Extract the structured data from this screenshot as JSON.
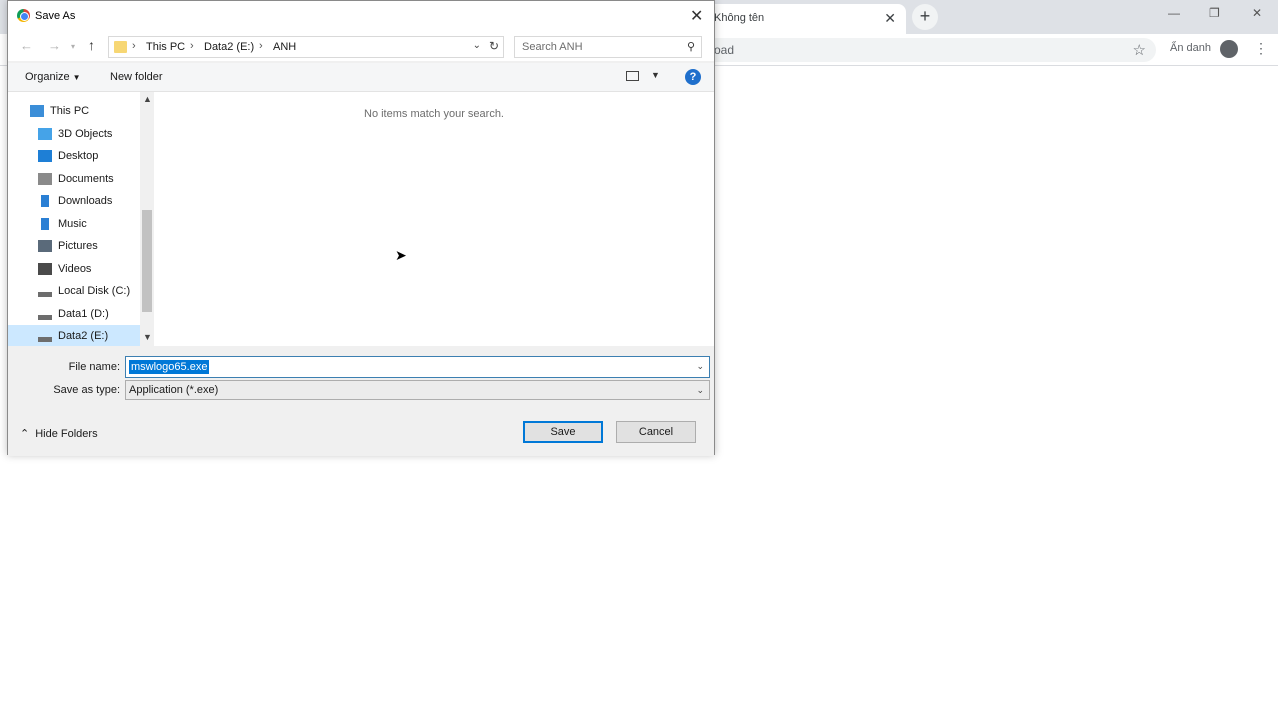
{
  "browser": {
    "tab_title": "Không tên",
    "tab_close": "✕",
    "newtab": "+",
    "window_controls": [
      "—",
      "❐",
      "✕"
    ],
    "omnibox_text": "oad",
    "incognito_label": "Ẩn danh"
  },
  "dialog": {
    "title": "Save As",
    "close": "✕",
    "breadcrumbs": [
      "This PC",
      "Data2 (E:)",
      "ANH"
    ],
    "search_placeholder": "Search ANH",
    "organize_label": "Organize",
    "new_folder_label": "New folder",
    "help": "?",
    "tree_items": [
      {
        "label": "This PC",
        "icon": "computer-icon",
        "color": "#3b8ed8"
      },
      {
        "label": "3D Objects",
        "icon": "cube-icon",
        "color": "#45a3e8"
      },
      {
        "label": "Desktop",
        "icon": "desktop-icon",
        "color": "#1e7fd6"
      },
      {
        "label": "Documents",
        "icon": "document-icon",
        "color": "#8a8a8a"
      },
      {
        "label": "Downloads",
        "icon": "download-icon",
        "color": "#2a7fd4"
      },
      {
        "label": "Music",
        "icon": "music-icon",
        "color": "#2a7fd4"
      },
      {
        "label": "Pictures",
        "icon": "pictures-icon",
        "color": "#5a6a7a"
      },
      {
        "label": "Videos",
        "icon": "video-icon",
        "color": "#4a4a4a"
      },
      {
        "label": "Local Disk (C:)",
        "icon": "drive-icon",
        "color": "#6d6d6d"
      },
      {
        "label": "Data1 (D:)",
        "icon": "drive-icon",
        "color": "#6d6d6d"
      },
      {
        "label": "Data2 (E:)",
        "icon": "drive-icon",
        "color": "#6d6d6d"
      }
    ],
    "selected_tree_item": "Data2 (E:)",
    "empty_message": "No items match your search.",
    "file_name_label": "File name:",
    "file_name_value": "mswlogo65.exe",
    "save_type_label": "Save as type:",
    "save_type_value": "Application (*.exe)",
    "hide_folders_label": "Hide Folders",
    "save_label": "Save",
    "cancel_label": "Cancel"
  }
}
